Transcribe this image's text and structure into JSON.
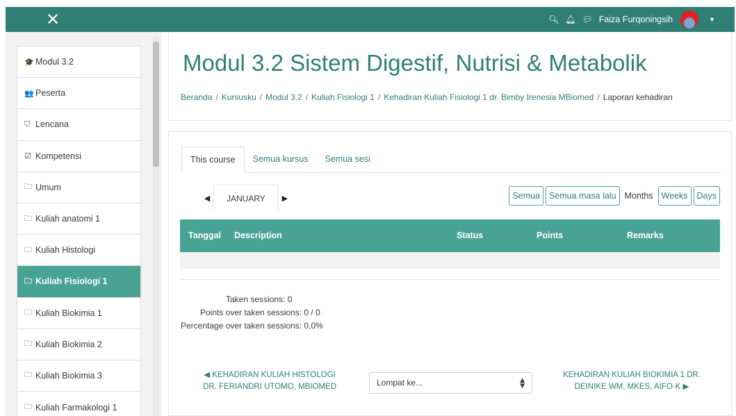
{
  "topbar": {
    "close_glyph": "✕",
    "user_name": "Faiza Furqoningsih",
    "icons": [
      "search-icon",
      "bell-icon",
      "chat-icon",
      "caret-down-icon"
    ],
    "color": "#2f7f74"
  },
  "sidebar": {
    "items": [
      {
        "icon": "graduation-cap-icon",
        "glyph": "🎓",
        "label": "Modul 3.2"
      },
      {
        "icon": "users-icon",
        "glyph": "👥",
        "label": "Peserta"
      },
      {
        "icon": "shield-icon",
        "glyph": "⛉",
        "label": "Lencana"
      },
      {
        "icon": "checkbox-icon",
        "glyph": "☑",
        "label": "Kompetensi"
      },
      {
        "icon": "folder-icon",
        "glyph": "🗀",
        "label": "Umum"
      },
      {
        "icon": "folder-icon",
        "glyph": "🗀",
        "label": "Kuliah anatomi 1"
      },
      {
        "icon": "folder-icon",
        "glyph": "🗀",
        "label": "Kuliah Histologi"
      },
      {
        "icon": "folder-icon",
        "glyph": "🗀",
        "label": "Kuliah Fisiologi 1",
        "active": true
      },
      {
        "icon": "folder-icon",
        "glyph": "🗀",
        "label": "Kuliah Biokimia 1"
      },
      {
        "icon": "folder-icon",
        "glyph": "🗀",
        "label": "Kuliah Biokimia 2"
      },
      {
        "icon": "folder-icon",
        "glyph": "🗀",
        "label": "Kuliah Biokimia 3"
      },
      {
        "icon": "folder-icon",
        "glyph": "🗀",
        "label": "Kuliah Farmakologi 1"
      }
    ],
    "active_color": "#48a394"
  },
  "header": {
    "title": "Modul 3.2 Sistem Digestif, Nutrisi & Metabolik",
    "breadcrumb": [
      "Beranda",
      "Kursusku",
      "Modul 3.2",
      "Kuliah Fisiologi 1",
      "Kehadiran Kuliah Fisiologi 1 dr. Bimby Irenesia MBiomed",
      "Laporan kehadiran"
    ]
  },
  "tabs": [
    "This course",
    "Semua kursus",
    "Semua sesi"
  ],
  "month_nav": {
    "label": "JANUARY",
    "prev": "◀",
    "next": "▶"
  },
  "view_buttons": {
    "all": "Semua",
    "all_past": "Semua masa lalu",
    "months": "Months",
    "weeks": "Weeks",
    "days": "Days"
  },
  "table": {
    "headers": [
      "Tanggal",
      "Description",
      "Status",
      "Points",
      "Remarks"
    ],
    "rows": []
  },
  "summary": {
    "taken_sessions": "Taken sessions: 0",
    "points": "Points over taken sessions: 0 / 0",
    "percentage": "Percentage over taken sessions: 0,0%"
  },
  "footer_nav": {
    "prev_line1": "◀ KEHADIRAN KULIAH HISTOLOGI",
    "prev_line2": "DR. FERIANDRI UTOMO, MBIOMED",
    "jump_placeholder": "Lompat ke...",
    "next_line1": "KEHADIRAN KULIAH BIOKIMIA 1 DR.",
    "next_line2": "DEINIKE WM, MKES, AIFO-K ▶"
  }
}
